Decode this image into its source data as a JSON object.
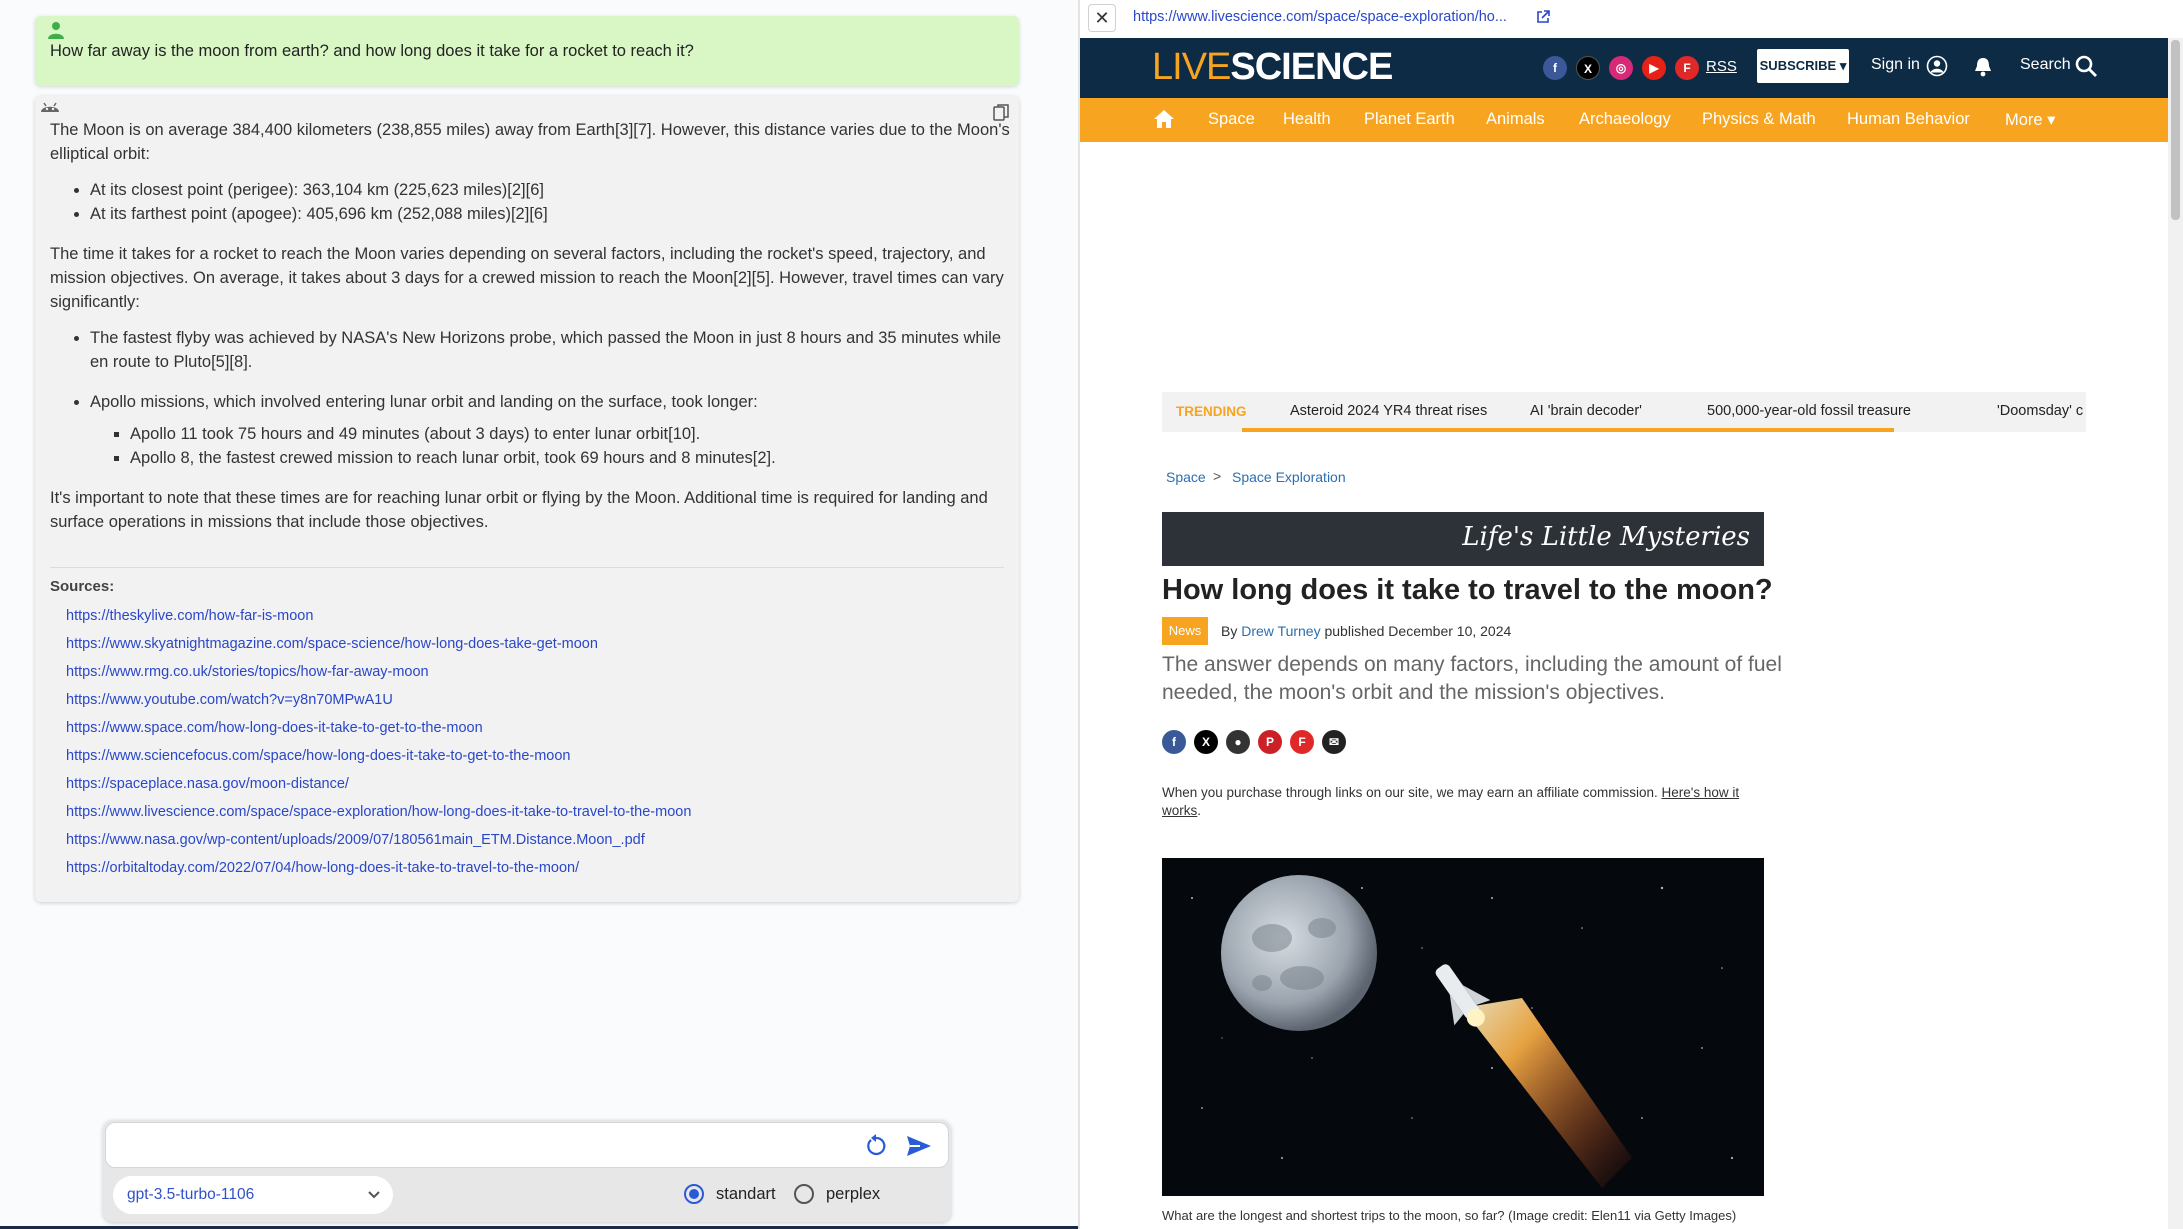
{
  "chat": {
    "user_question": "How far away is the moon from earth? and how long does it take for a rocket to reach it?",
    "answer": {
      "p1": "The Moon is on average 384,400 kilometers (238,855 miles) away from Earth[3][7]. However, this distance varies due to the Moon's elliptical orbit:",
      "list1": [
        "At its closest point (perigee): 363,104 km (225,623 miles)[2][6]",
        "At its farthest point (apogee): 405,696 km (252,088 miles)[2][6]"
      ],
      "p2": "The time it takes for a rocket to reach the Moon varies depending on several factors, including the rocket's speed, trajectory, and mission objectives. On average, it takes about 3 days for a crewed mission to reach the Moon[2][5]. However, travel times can vary significantly:",
      "list2": [
        "The fastest flyby was achieved by NASA's New Horizons probe, which passed the Moon in just 8 hours and 35 minutes while en route to Pluto[5][8].",
        "Apollo missions, which involved entering lunar orbit and landing on the surface, took longer:"
      ],
      "sublist": [
        "Apollo 11 took 75 hours and 49 minutes (about 3 days) to enter lunar orbit[10].",
        "Apollo 8, the fastest crewed mission to reach lunar orbit, took 69 hours and 8 minutes[2]."
      ],
      "p3": "It's important to note that these times are for reaching lunar orbit or flying by the Moon. Additional time is required for landing and surface operations in missions that include those objectives."
    },
    "sources_title": "Sources:",
    "sources": [
      "https://theskylive.com/how-far-is-moon",
      "https://www.skyatnightmagazine.com/space-science/how-long-does-take-get-moon",
      "https://www.rmg.co.uk/stories/topics/how-far-away-moon",
      "https://www.youtube.com/watch?v=y8n70MPwA1U",
      "https://www.space.com/how-long-does-it-take-to-get-to-the-moon",
      "https://www.sciencefocus.com/space/how-long-does-it-take-to-get-to-the-moon",
      "https://spaceplace.nasa.gov/moon-distance/",
      "https://www.livescience.com/space/space-exploration/how-long-does-it-take-to-travel-to-the-moon",
      "https://www.nasa.gov/wp-content/uploads/2009/07/180561main_ETM.Distance.Moon_.pdf",
      "https://orbitaltoday.com/2022/07/04/how-long-does-it-take-to-travel-to-the-moon/"
    ],
    "input_placeholder": "",
    "model": "gpt-3.5-turbo-1106",
    "modes": [
      {
        "label": "standart",
        "selected": true
      },
      {
        "label": "perplex",
        "selected": false
      }
    ]
  },
  "browser": {
    "close_glyph": "✕",
    "url": "https://www.livescience.com/space/space-exploration/ho...",
    "site": {
      "logo_a": "LIVE",
      "logo_b": "SCIENCE",
      "social": [
        "facebook-icon",
        "x-icon",
        "instagram-icon",
        "youtube-icon",
        "flipboard-icon"
      ],
      "rss": "RSS",
      "subscribe": "SUBSCRIBE ▾",
      "sign_in": "Sign in",
      "search": "Search",
      "nav": [
        "Space",
        "Health",
        "Planet Earth",
        "Animals",
        "Archaeology",
        "Physics & Math",
        "Human Behavior",
        "More ▾"
      ],
      "trending_label": "TRENDING",
      "trending": [
        "Asteroid 2024 YR4 threat rises",
        "AI 'brain decoder'",
        "500,000-year-old fossil treasure",
        "'Doomsday' c"
      ],
      "breadcrumb": [
        "Space",
        "Space Exploration"
      ],
      "breadcrumb_sep": ">",
      "banner": "Life's Little Mysteries",
      "headline": "How long does it take to travel to the moon?",
      "badge": "News",
      "by": "By",
      "author": "Drew Turney",
      "published": "published December 10, 2024",
      "standfirst": "The answer depends on many factors, including the amount of fuel needed, the moon's orbit and the mission's objectives.",
      "affiliate": "When you purchase through links on our site, we may earn an affiliate commission.",
      "affiliate_link": "Here's how it works",
      "caption": "What are the longest and shortest trips to the moon, so far? (Image credit: Elen11 via Getty Images)",
      "colors": {
        "navy": "#0d2b45",
        "orange": "#f7a421"
      }
    }
  }
}
